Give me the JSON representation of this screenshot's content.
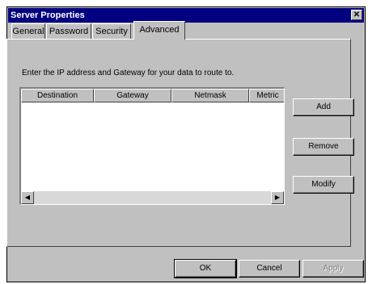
{
  "window": {
    "title": "Server Properties",
    "close_glyph": "✕"
  },
  "tabs": [
    {
      "label": "General"
    },
    {
      "label": "Password"
    },
    {
      "label": "Security"
    },
    {
      "label": "Advanced",
      "active": true
    }
  ],
  "instruction": "Enter the IP address and Gateway for your data to route to.",
  "route_list": {
    "columns": [
      "Destination",
      "Gateway",
      "Netmask",
      "Metric"
    ],
    "rows": [],
    "scroll_left_glyph": "◀",
    "scroll_right_glyph": "▶"
  },
  "side_buttons": {
    "add": "Add",
    "remove": "Remove",
    "modify": "Modify"
  },
  "footer_buttons": {
    "ok": "OK",
    "cancel": "Cancel",
    "apply": "Apply"
  }
}
